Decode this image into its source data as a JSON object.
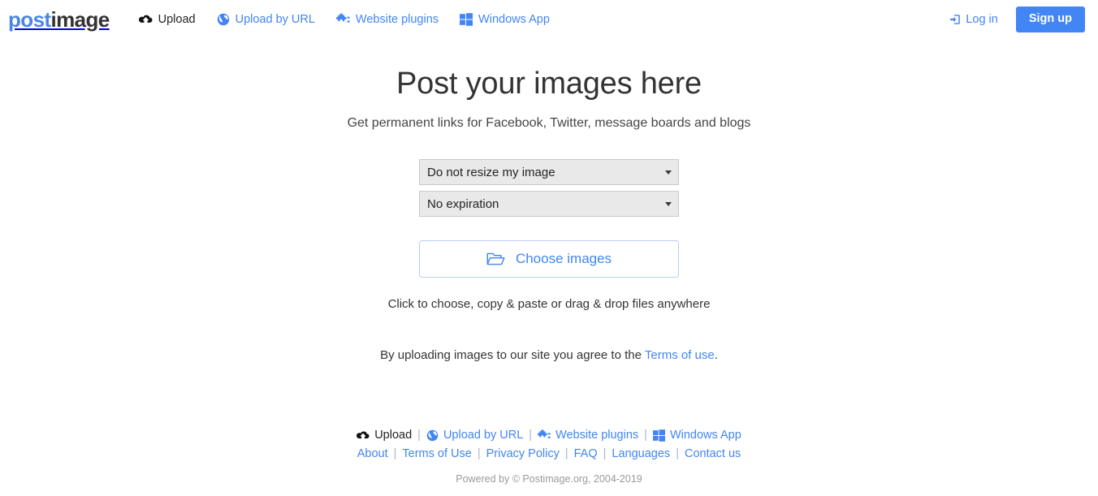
{
  "header": {
    "logo": {
      "part1": "post",
      "part2": "image"
    },
    "nav": [
      {
        "label": "Upload",
        "icon": "cloud-upload-icon",
        "active": true
      },
      {
        "label": "Upload by URL",
        "icon": "globe-icon",
        "active": false
      },
      {
        "label": "Website plugins",
        "icon": "puzzle-piece-icon",
        "active": false
      },
      {
        "label": "Windows App",
        "icon": "windows-logo-icon",
        "active": false
      }
    ],
    "login_label": "Log in",
    "login_icon": "sign-in-icon",
    "signup_label": "Sign up"
  },
  "main": {
    "title": "Post your images here",
    "subtitle": "Get permanent links for Facebook, Twitter, message boards and blogs",
    "resize_select": {
      "value": "Do not resize my image"
    },
    "expiration_select": {
      "value": "No expiration"
    },
    "choose_button": {
      "label": "Choose images",
      "icon": "open-folder-icon"
    },
    "hint": "Click to choose, copy & paste or drag & drop files anywhere",
    "terms": {
      "prefix": "By uploading images to our site you agree to the ",
      "link": "Terms of use",
      "suffix": "."
    }
  },
  "footer": {
    "row1": [
      {
        "label": "Upload",
        "icon": "cloud-upload-icon",
        "dark": true
      },
      {
        "label": "Upload by URL",
        "icon": "globe-icon",
        "dark": false
      },
      {
        "label": "Website plugins",
        "icon": "puzzle-piece-icon",
        "dark": false
      },
      {
        "label": "Windows App",
        "icon": "windows-logo-icon",
        "dark": false
      }
    ],
    "row2": [
      "About",
      "Terms of Use",
      "Privacy Policy",
      "FAQ",
      "Languages",
      "Contact us"
    ],
    "separator": "|",
    "copyright": "Powered by © Postimage.org, 2004-2019"
  },
  "colors": {
    "brand_blue": "#4285f4",
    "logo_blue": "#4a86e8",
    "text_dark": "#333333",
    "select_bg": "#e9e9e9",
    "muted": "#9a9a9a"
  }
}
